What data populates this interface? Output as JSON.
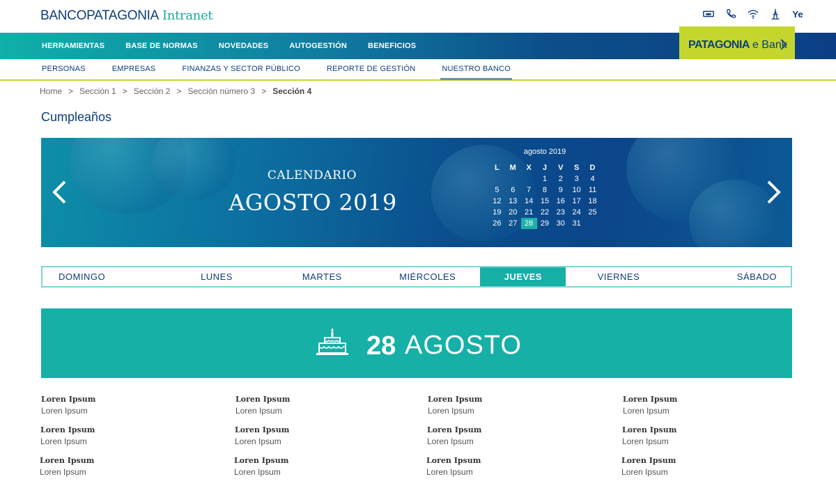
{
  "header": {
    "brand": "BANCOPATAGONIA",
    "suffix": "Intranet",
    "icons": [
      "atm-icon",
      "phone-icon",
      "wifi-icon",
      "tower-icon",
      "ye-icon"
    ],
    "ye_label": "Ye"
  },
  "main_nav": {
    "items": [
      "HERRAMIENTAS",
      "BASE DE NORMAS",
      "NOVEDADES",
      "AUTOGESTIÓN",
      "BENEFICIOS"
    ]
  },
  "ebank": {
    "part1": "PATAGONIA",
    "part2": "e Bank"
  },
  "sub_nav": {
    "items": [
      "PERSONAS",
      "EMPRESAS",
      "FINANZAS Y SECTOR PÚBLICO",
      "REPORTE DE GESTIÓN",
      "NUESTRO BANCO"
    ],
    "active_index": 4
  },
  "breadcrumb": {
    "items": [
      "Home",
      "Sección 1",
      "Sección 2",
      "Sección número 3",
      "Sección 4"
    ],
    "separator": ">"
  },
  "page_title": "Cumpleaños",
  "banner": {
    "label": "CALENDARIO",
    "title": "AGOSTO 2019",
    "calendar": {
      "title": "agosto 2019",
      "weekdays": [
        "L",
        "M",
        "X",
        "J",
        "V",
        "S",
        "D"
      ],
      "weeks": [
        [
          "",
          "",
          "",
          "1",
          "2",
          "3",
          "4"
        ],
        [
          "5",
          "6",
          "7",
          "8",
          "9",
          "10",
          "11"
        ],
        [
          "12",
          "13",
          "14",
          "15",
          "16",
          "17",
          "18"
        ],
        [
          "19",
          "20",
          "21",
          "22",
          "23",
          "24",
          "25"
        ],
        [
          "26",
          "27",
          "28",
          "29",
          "30",
          "31",
          ""
        ]
      ],
      "selected": "28"
    }
  },
  "days": {
    "items": [
      "DOMINGO",
      "LUNES",
      "MARTES",
      "MIÉRCOLES",
      "JUEVES",
      "VIERNES",
      "SÁBADO"
    ],
    "active_index": 4
  },
  "birthday": {
    "day": "28",
    "month": "AGOSTO"
  },
  "people": [
    {
      "name": "Loren Ipsum",
      "role": "Loren Ipsum"
    },
    {
      "name": "Loren Ipsum",
      "role": "Loren Ipsum"
    },
    {
      "name": "Loren Ipsum",
      "role": "Loren Ipsum"
    },
    {
      "name": "Loren Ipsum",
      "role": "Loren Ipsum"
    },
    {
      "name": "Loren Ipsum",
      "role": "Loren Ipsum"
    },
    {
      "name": "Loren Ipsum",
      "role": "Loren Ipsum"
    },
    {
      "name": "Loren Ipsum",
      "role": "Loren Ipsum"
    },
    {
      "name": "Loren Ipsum",
      "role": "Loren Ipsum"
    },
    {
      "name": "Loren Ipsum",
      "role": "Loren Ipsum"
    },
    {
      "name": "Loren Ipsum",
      "role": "Loren Ipsum"
    },
    {
      "name": "Loren Ipsum",
      "role": "Loren Ipsum"
    },
    {
      "name": "Loren Ipsum",
      "role": "Loren Ipsum"
    }
  ],
  "colors": {
    "navy": "#0d3d7a",
    "teal": "#16b0a7",
    "lime": "#c4d62e"
  }
}
